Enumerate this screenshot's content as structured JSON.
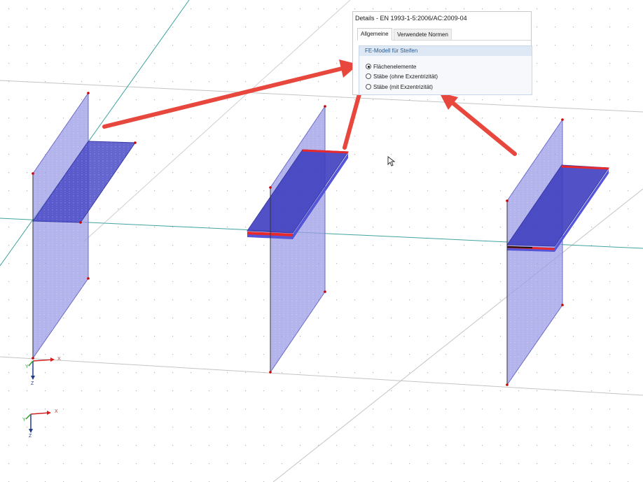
{
  "dialog": {
    "title": "Details - EN 1993-1-5:2006/AC:2009-04",
    "tabs": [
      {
        "label": "Allgemeine",
        "active": true
      },
      {
        "label": "Verwendete Normen",
        "active": false
      }
    ],
    "group": {
      "title": "FE-Modell für Steifen",
      "options": [
        {
          "label": "Flächenelemente",
          "selected": true
        },
        {
          "label": "Stäbe (ohne Exzentrizität)",
          "selected": false
        },
        {
          "label": "Stäbe (mit Exzentrizität)",
          "selected": false
        }
      ]
    }
  },
  "axes": {
    "x_label": "X",
    "y_label": "Y",
    "z_label": "Z"
  },
  "colors": {
    "plate_fill": "#9b9be6",
    "stiffener_fill": "#4a4ac8",
    "member_red": "#e8292c",
    "arrow_red": "#e8473d",
    "grid_line": "#bcbcbc",
    "teal_line": "#3fa3a0"
  }
}
